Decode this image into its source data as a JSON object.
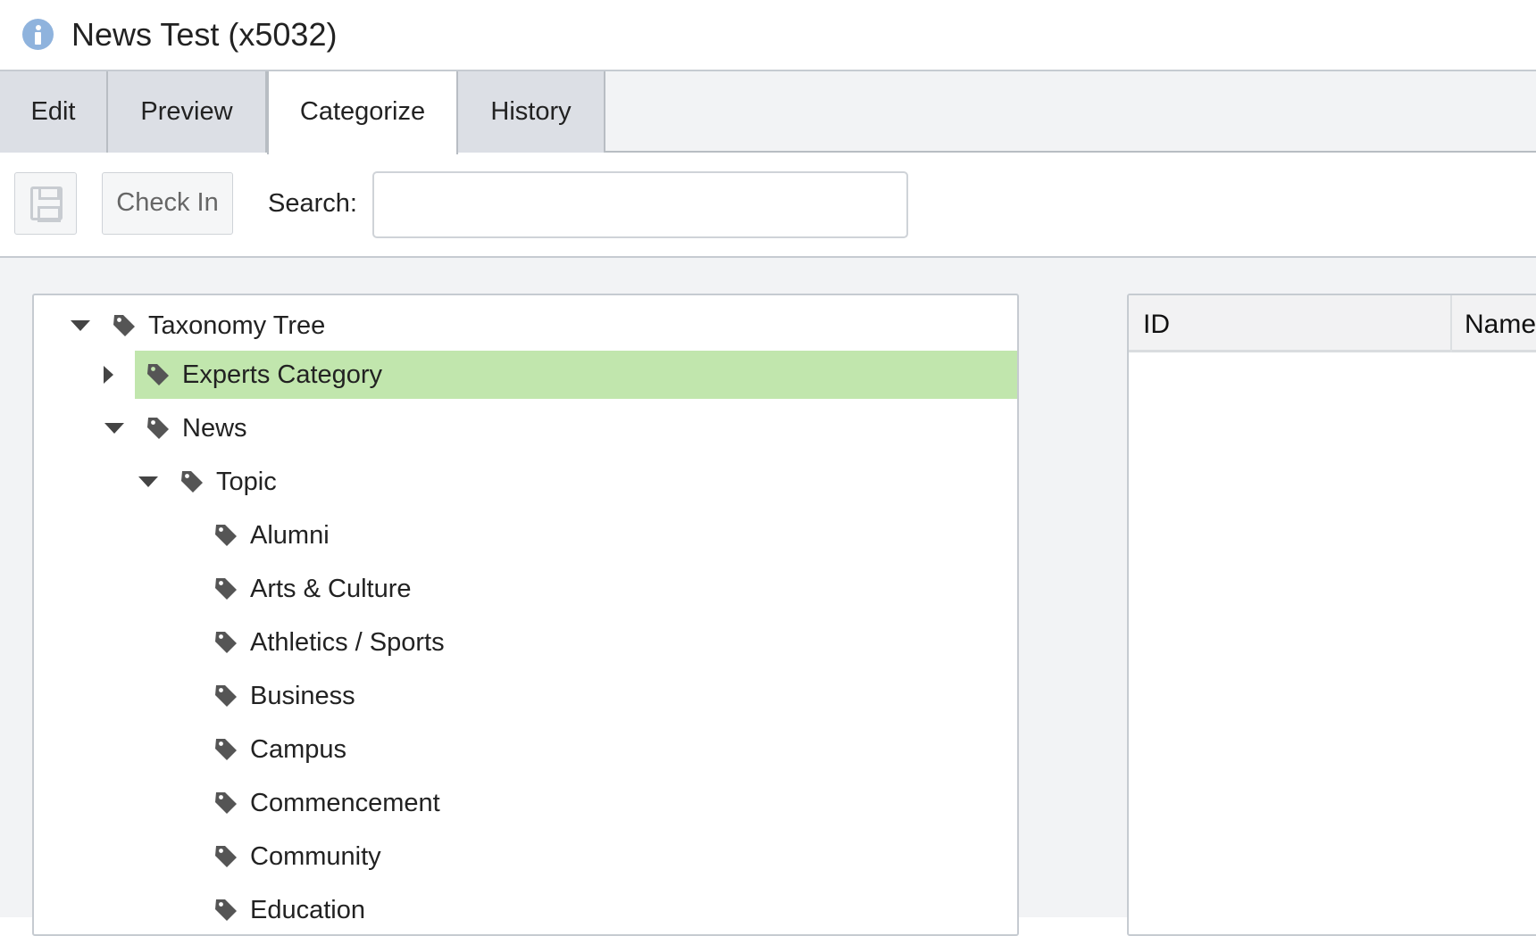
{
  "header": {
    "title": "News Test (x5032)",
    "icon": "info-icon"
  },
  "tabs": [
    {
      "label": "Edit",
      "active": false
    },
    {
      "label": "Preview",
      "active": false
    },
    {
      "label": "Categorize",
      "active": true
    },
    {
      "label": "History",
      "active": false
    }
  ],
  "toolbar": {
    "save_icon": "floppy-disk-icon",
    "checkin_label": "Check In",
    "search_label": "Search:",
    "search_value": "",
    "search_placeholder": ""
  },
  "tree": {
    "nodes": [
      {
        "label": "Taxonomy Tree",
        "level": 0,
        "expander": "expanded",
        "selected": false
      },
      {
        "label": "Experts Category",
        "level": 1,
        "expander": "collapsed",
        "selected": true
      },
      {
        "label": "News",
        "level": 1,
        "expander": "expanded",
        "selected": false
      },
      {
        "label": "Topic",
        "level": 2,
        "expander": "expanded",
        "selected": false
      },
      {
        "label": "Alumni",
        "level": 3,
        "expander": "none",
        "selected": false
      },
      {
        "label": "Arts & Culture",
        "level": 3,
        "expander": "none",
        "selected": false
      },
      {
        "label": "Athletics / Sports",
        "level": 3,
        "expander": "none",
        "selected": false
      },
      {
        "label": "Business",
        "level": 3,
        "expander": "none",
        "selected": false
      },
      {
        "label": "Campus",
        "level": 3,
        "expander": "none",
        "selected": false
      },
      {
        "label": "Commencement",
        "level": 3,
        "expander": "none",
        "selected": false
      },
      {
        "label": "Community",
        "level": 3,
        "expander": "none",
        "selected": false
      },
      {
        "label": "Education",
        "level": 3,
        "expander": "none",
        "selected": false
      }
    ]
  },
  "grid": {
    "columns": [
      "ID",
      "Name"
    ]
  },
  "colors": {
    "selected_row": "#c1e6ad",
    "tab_inactive": "#dcdfe5",
    "tag_icon": "#555555"
  }
}
